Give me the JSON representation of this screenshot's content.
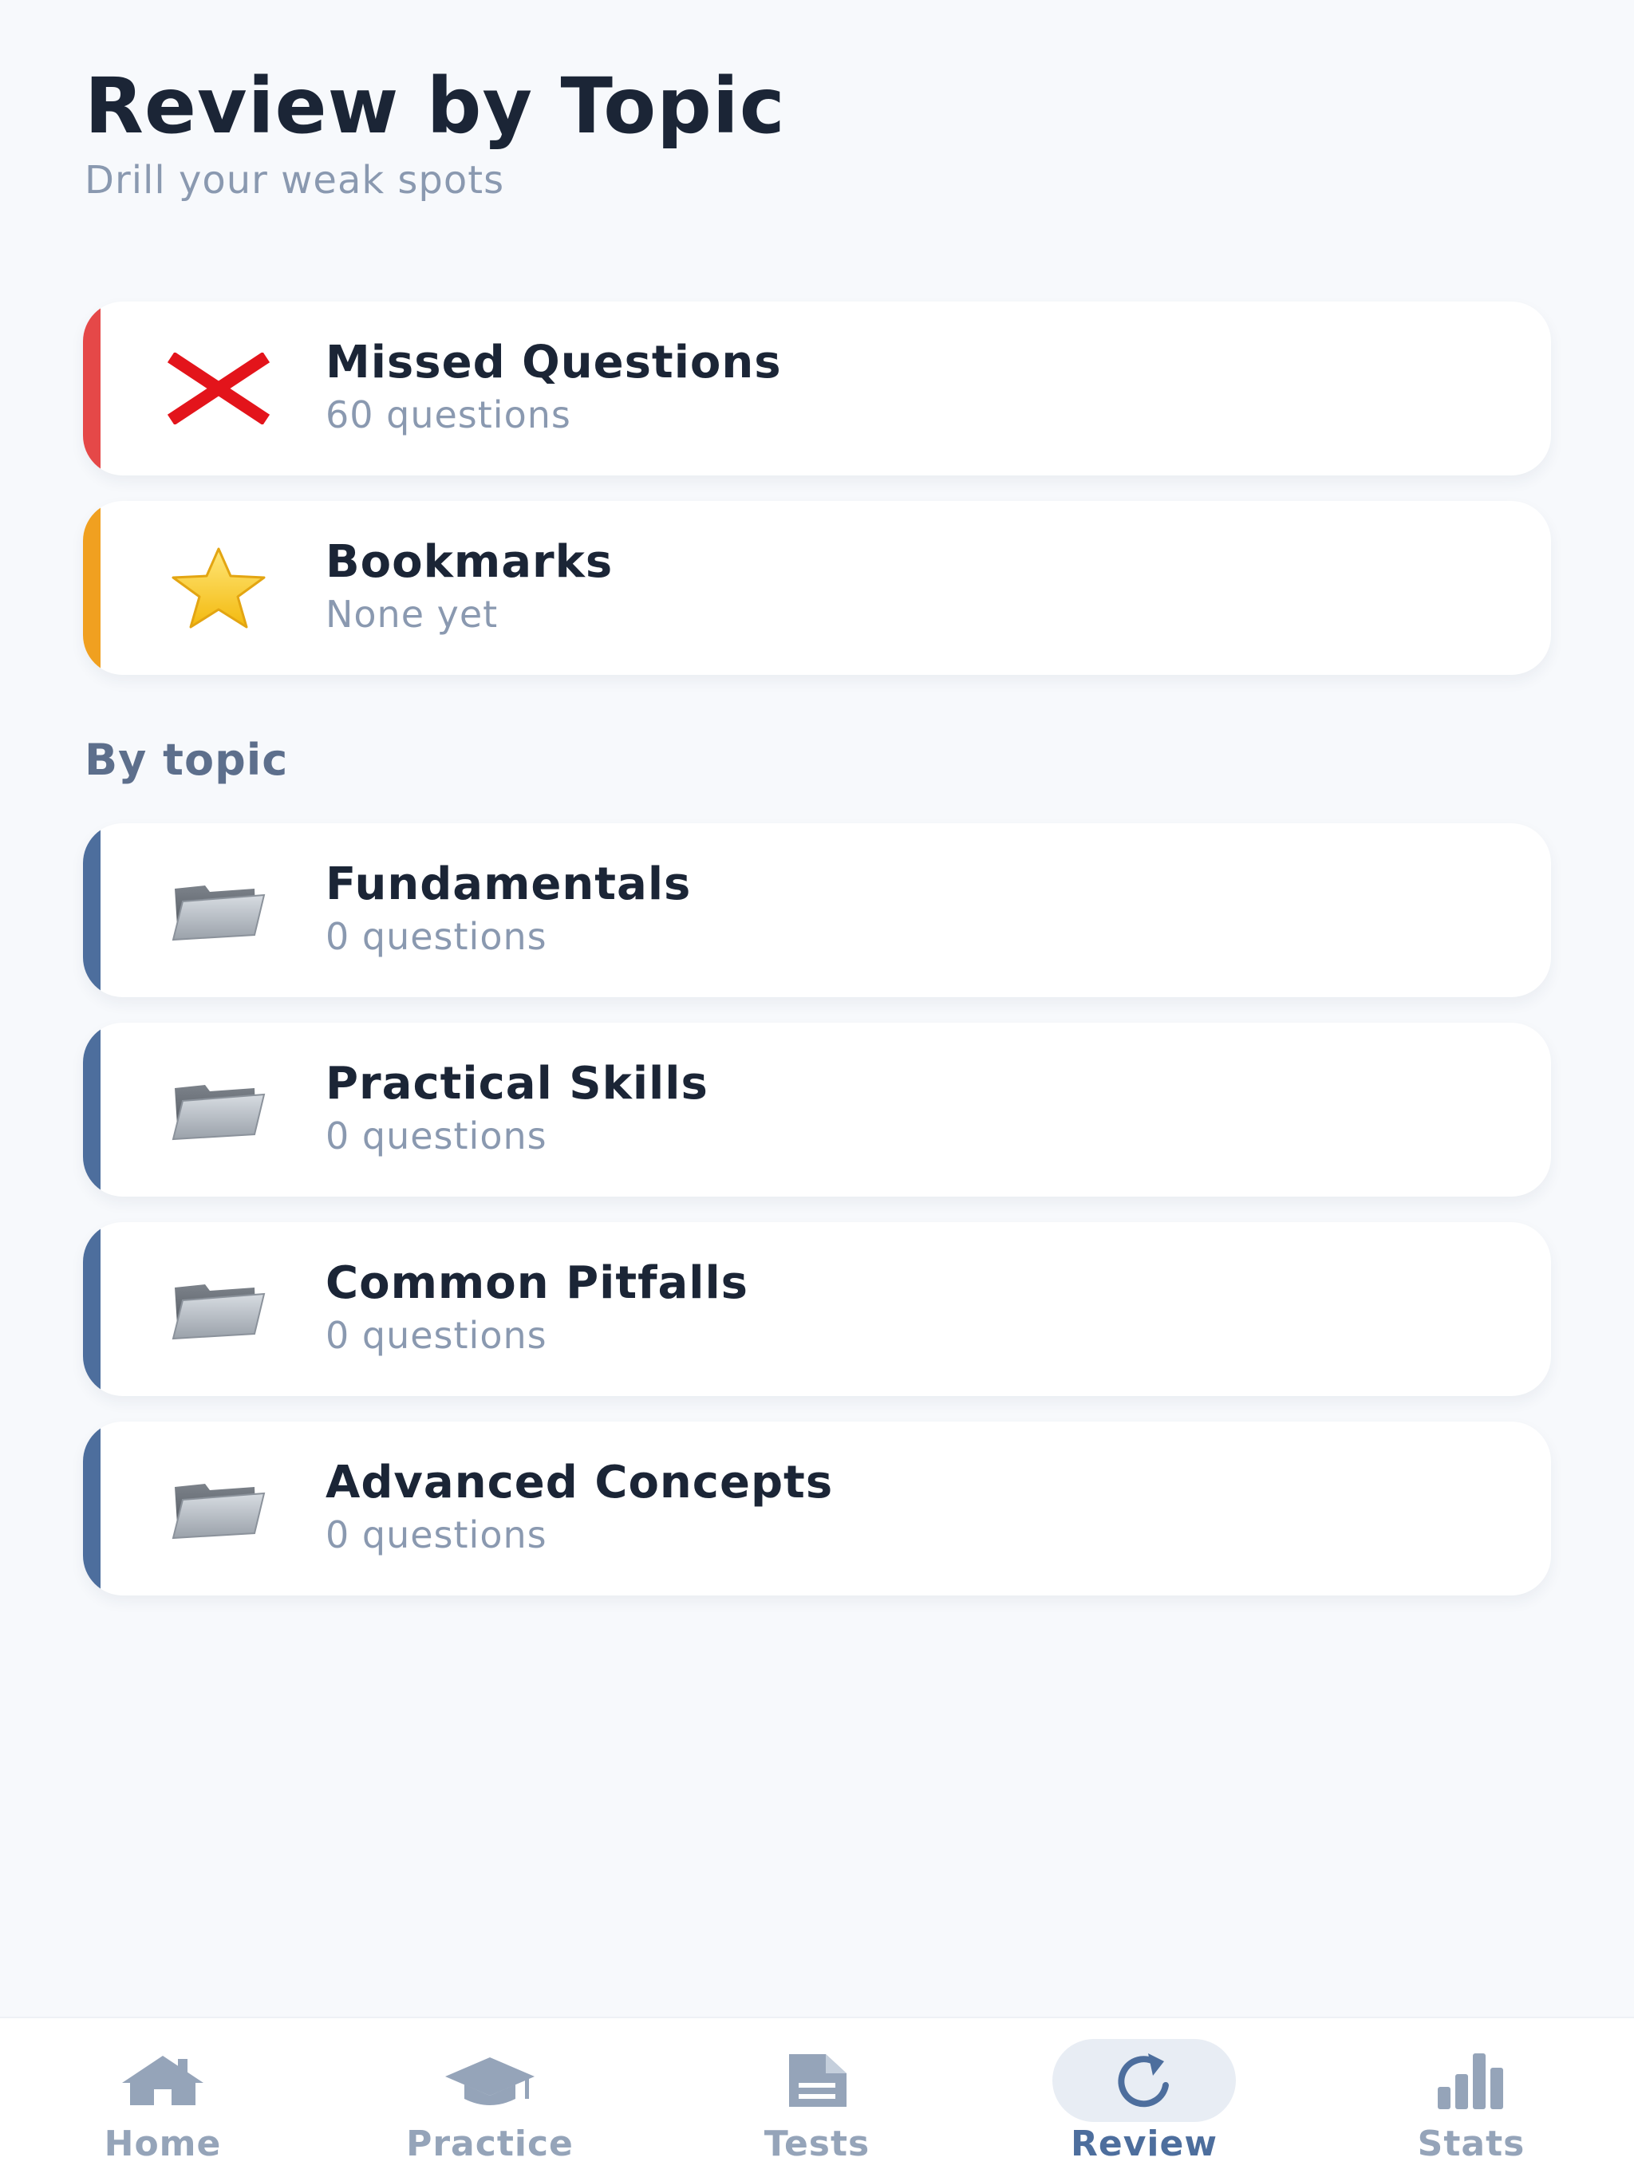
{
  "header": {
    "title": "Review by Topic",
    "subtitle": "Drill your weak spots"
  },
  "special_cards": [
    {
      "title": "Missed Questions",
      "subtitle": "60 questions",
      "icon": "red-x-icon",
      "accent_color": "#e54848"
    },
    {
      "title": "Bookmarks",
      "subtitle": "None yet",
      "icon": "star-icon",
      "accent_color": "#f0a020"
    }
  ],
  "section_label": "By topic",
  "topics": [
    {
      "title": "Fundamentals",
      "subtitle": "0 questions",
      "icon": "folder-icon",
      "accent_color": "#4d6e9d"
    },
    {
      "title": "Practical Skills",
      "subtitle": "0 questions",
      "icon": "folder-icon",
      "accent_color": "#4d6e9d"
    },
    {
      "title": "Common Pitfalls",
      "subtitle": "0 questions",
      "icon": "folder-icon",
      "accent_color": "#4d6e9d"
    },
    {
      "title": "Advanced Concepts",
      "subtitle": "0 questions",
      "icon": "folder-icon",
      "accent_color": "#4d6e9d"
    }
  ],
  "nav": {
    "items": [
      {
        "label": "Home",
        "icon": "home-icon"
      },
      {
        "label": "Practice",
        "icon": "graduation-cap-icon"
      },
      {
        "label": "Tests",
        "icon": "document-icon"
      },
      {
        "label": "Review",
        "icon": "refresh-icon"
      },
      {
        "label": "Stats",
        "icon": "bar-chart-icon"
      }
    ],
    "active_label": "Review",
    "active_color": "#4d6e9d",
    "inactive_color": "#95a4b9"
  }
}
